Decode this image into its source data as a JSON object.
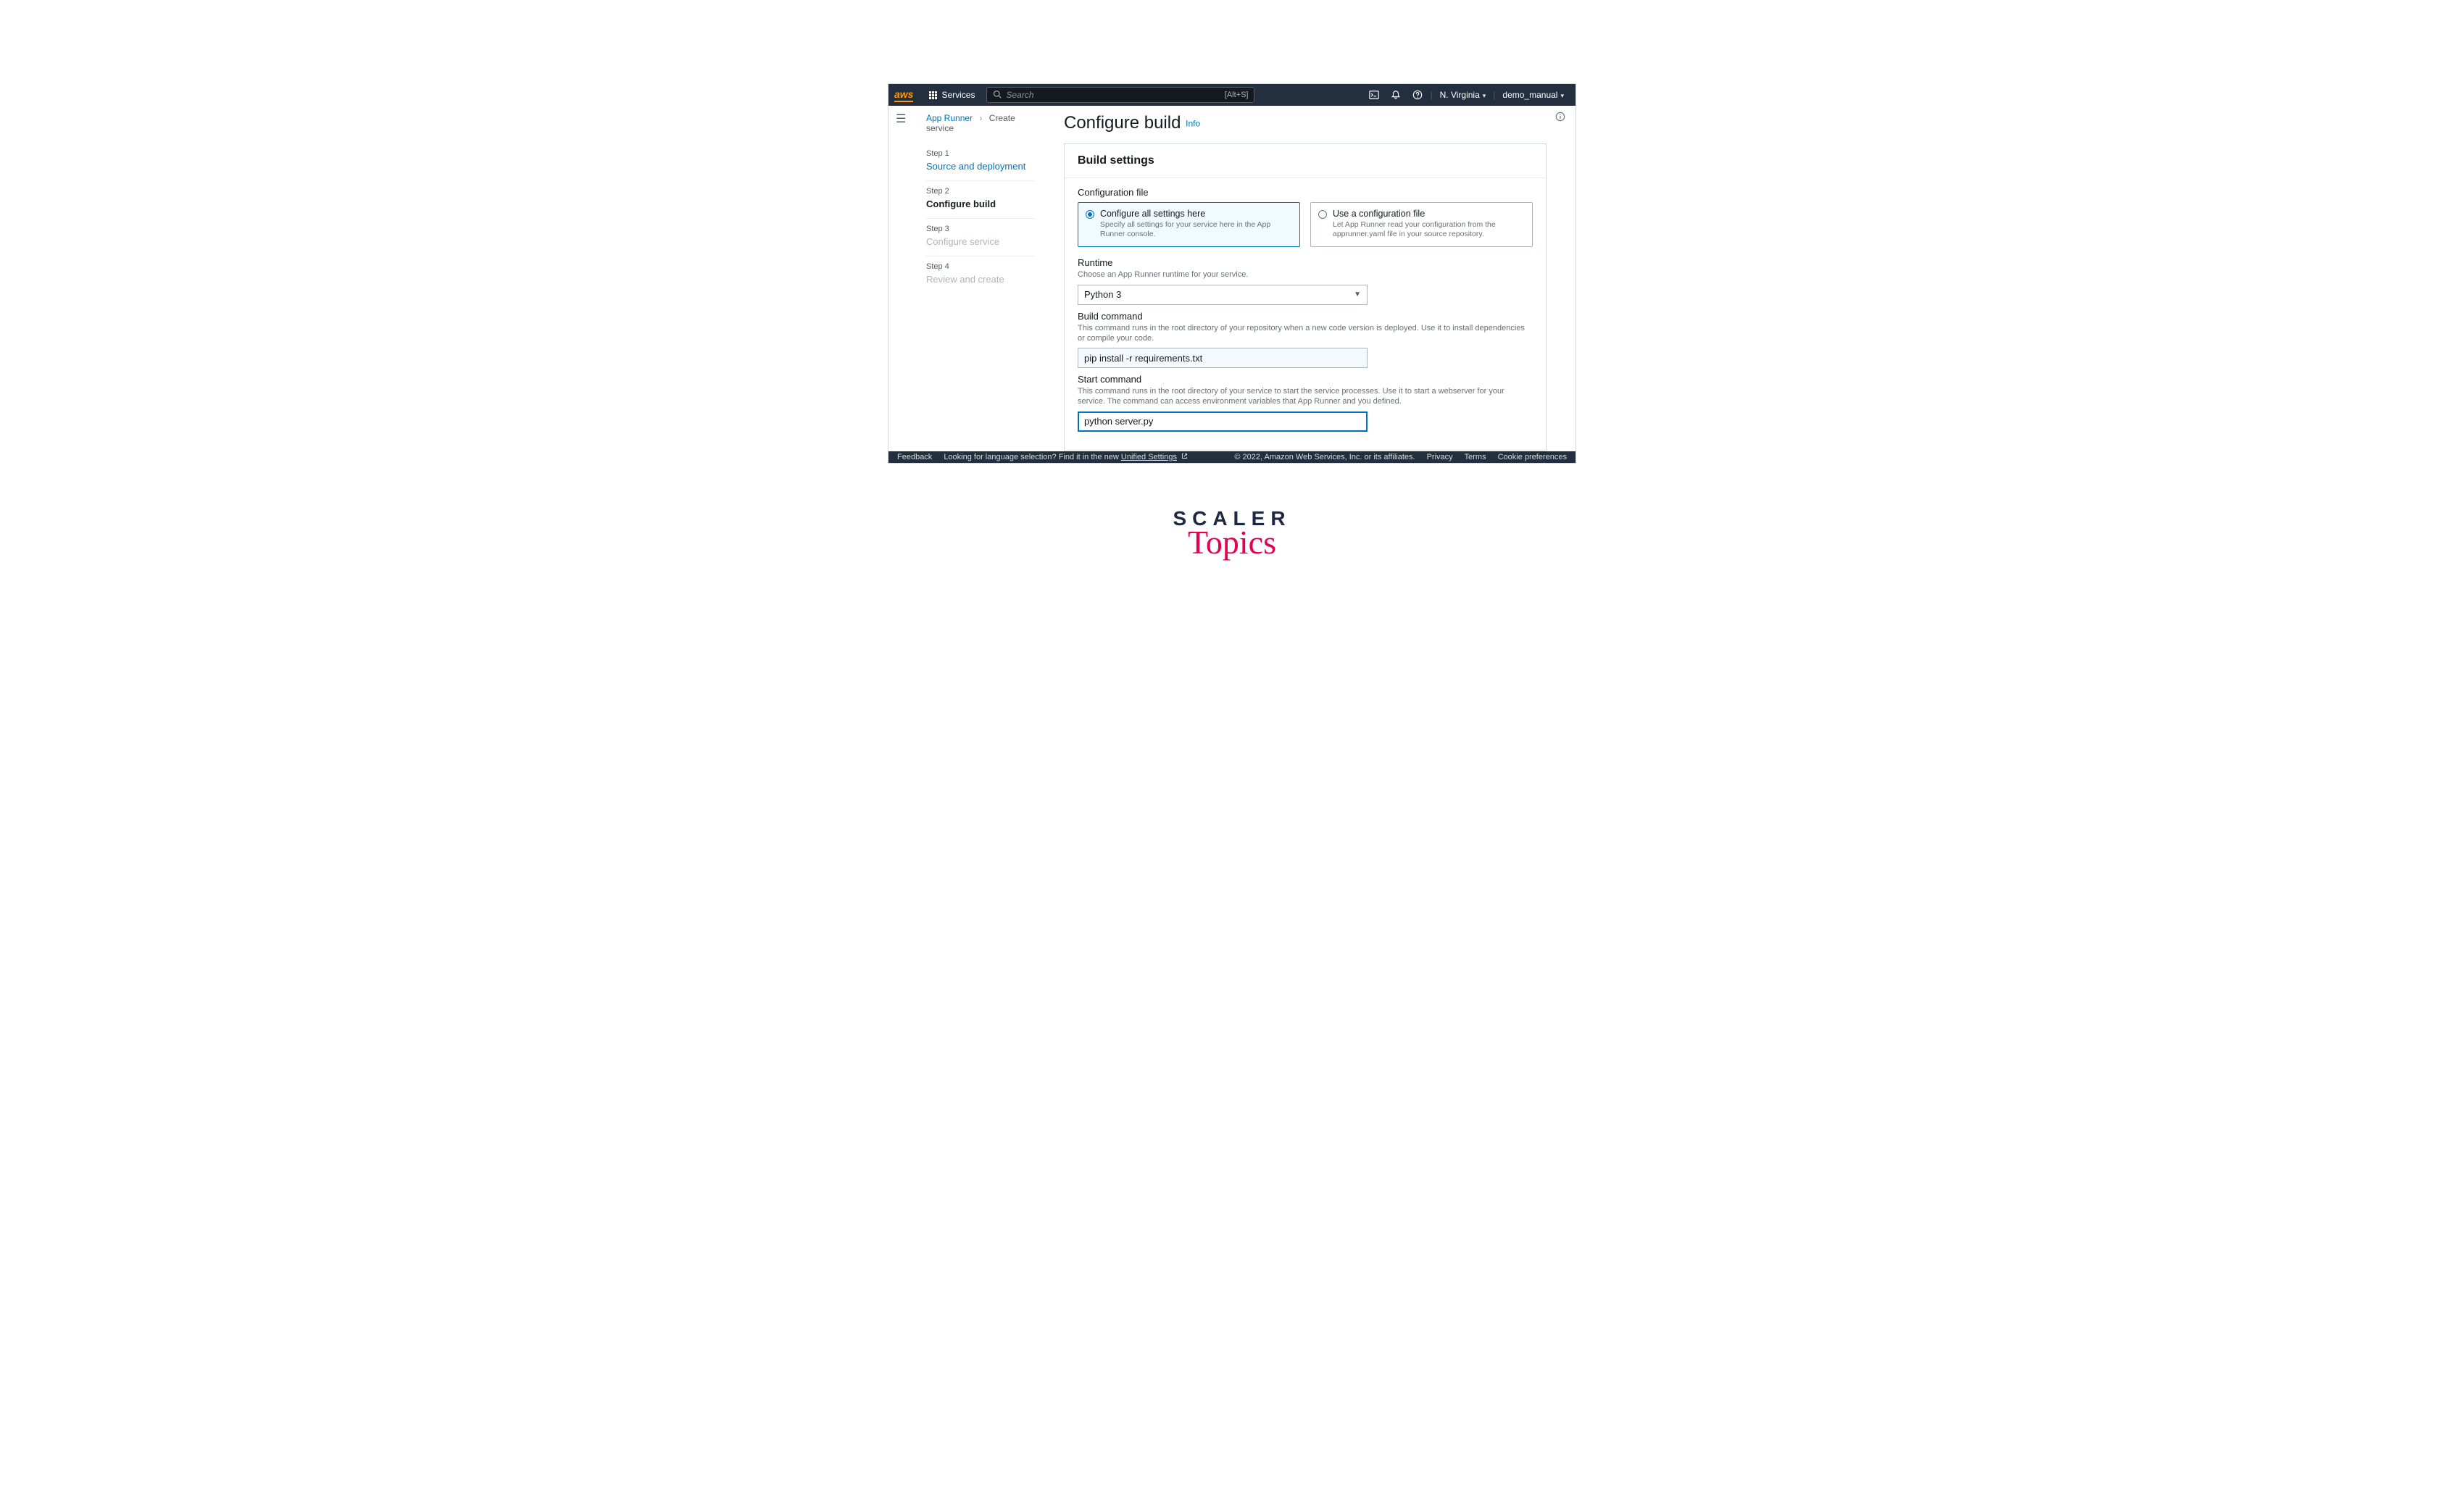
{
  "topnav": {
    "logo": "aws",
    "services": "Services",
    "search_placeholder": "Search",
    "search_shortcut": "[Alt+S]",
    "region": "N. Virginia",
    "user": "demo_manual"
  },
  "breadcrumb": {
    "root": "App Runner",
    "current": "Create service"
  },
  "steps": [
    {
      "label": "Step 1",
      "name": "Source and deployment"
    },
    {
      "label": "Step 2",
      "name": "Configure build"
    },
    {
      "label": "Step 3",
      "name": "Configure service"
    },
    {
      "label": "Step 4",
      "name": "Review and create"
    }
  ],
  "page": {
    "title": "Configure build",
    "info": "Info"
  },
  "build": {
    "panel_title": "Build settings",
    "config_label": "Configuration file",
    "option_here": {
      "title": "Configure all settings here",
      "desc": "Specify all settings for your service here in the App Runner console."
    },
    "option_file": {
      "title": "Use a configuration file",
      "desc": "Let App Runner read your configuration from the apprunner.yaml file in your source repository."
    },
    "runtime": {
      "label": "Runtime",
      "desc": "Choose an App Runner runtime for your service.",
      "value": "Python 3"
    },
    "build_cmd": {
      "label": "Build command",
      "desc": "This command runs in the root directory of your repository when a new code version is deployed. Use it to install dependencies or compile your code.",
      "value": "pip install -r requirements.txt"
    },
    "start_cmd": {
      "label": "Start command",
      "desc": "This command runs in the root directory of your service to start the service processes. Use it to start a webserver for your service. The command can access environment variables that App Runner and you defined.",
      "value": "python server.py"
    }
  },
  "footer": {
    "feedback": "Feedback",
    "lang_prefix": "Looking for language selection? Find it in the new ",
    "lang_link": "Unified Settings",
    "copyright": "© 2022, Amazon Web Services, Inc. or its affiliates.",
    "privacy": "Privacy",
    "terms": "Terms",
    "cookies": "Cookie preferences"
  },
  "watermark": {
    "line1": "SCALER",
    "line2": "Topics"
  }
}
